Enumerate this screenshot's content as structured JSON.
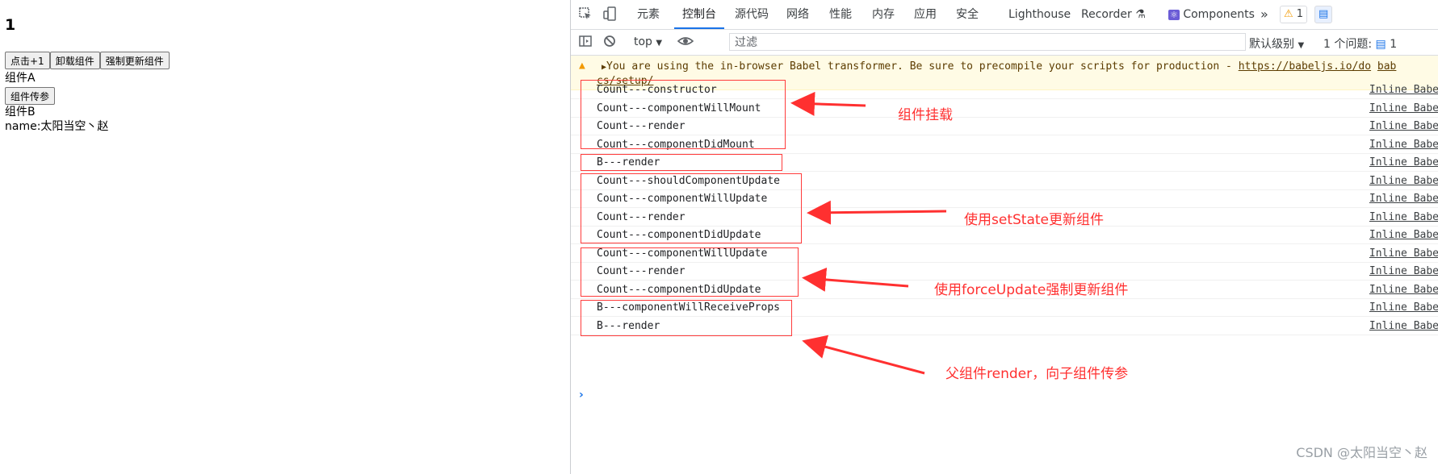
{
  "app": {
    "count": "1",
    "buttons": [
      "点击+1",
      "卸载组件",
      "强制更新组件"
    ],
    "component_a": "组件A",
    "pass_button": "组件传参",
    "component_b": "组件B",
    "name_line": "name:太阳当空丶赵"
  },
  "devtools": {
    "tabs": [
      "元素",
      "控制台",
      "源代码",
      "网络",
      "性能",
      "内存",
      "应用",
      "安全",
      "Lighthouse",
      "Recorder",
      "Components"
    ],
    "active_tab": "控制台",
    "more": "»",
    "warn_badge": "1",
    "msg_badge": "1",
    "context": "top",
    "filter_placeholder": "过滤",
    "level": "默认级别",
    "issues": "1 个问题:",
    "issues_count": "1",
    "warning_line1_text": "You are using the in-browser Babel transformer. Be sure to precompile your scripts for production - ",
    "warning_link1": "https://babeljs.io/do",
    "warning_link1b": "bab",
    "warning_link2": "cs/setup/",
    "source_label": "Inline Babe",
    "logs": [
      "Count---constructor",
      "Count---componentWillMount",
      "Count---render",
      "Count---componentDidMount",
      "B---render",
      "Count---shouldComponentUpdate",
      "Count---componentWillUpdate",
      "Count---render",
      "Count---componentDidUpdate",
      "Count---componentWillUpdate",
      "Count---render",
      "Count---componentDidUpdate",
      "B---componentWillReceiveProps",
      "B---render"
    ]
  },
  "annotations": [
    "组件挂载",
    "使用setState更新组件",
    "使用forceUpdate强制更新组件",
    "父组件render，向子组件传参"
  ],
  "watermark": "CSDN @太阳当空丶赵",
  "colors": {
    "annotation": "#ff3030",
    "active_tab": "#1a73e8",
    "warning_bg": "#fffbe5"
  }
}
